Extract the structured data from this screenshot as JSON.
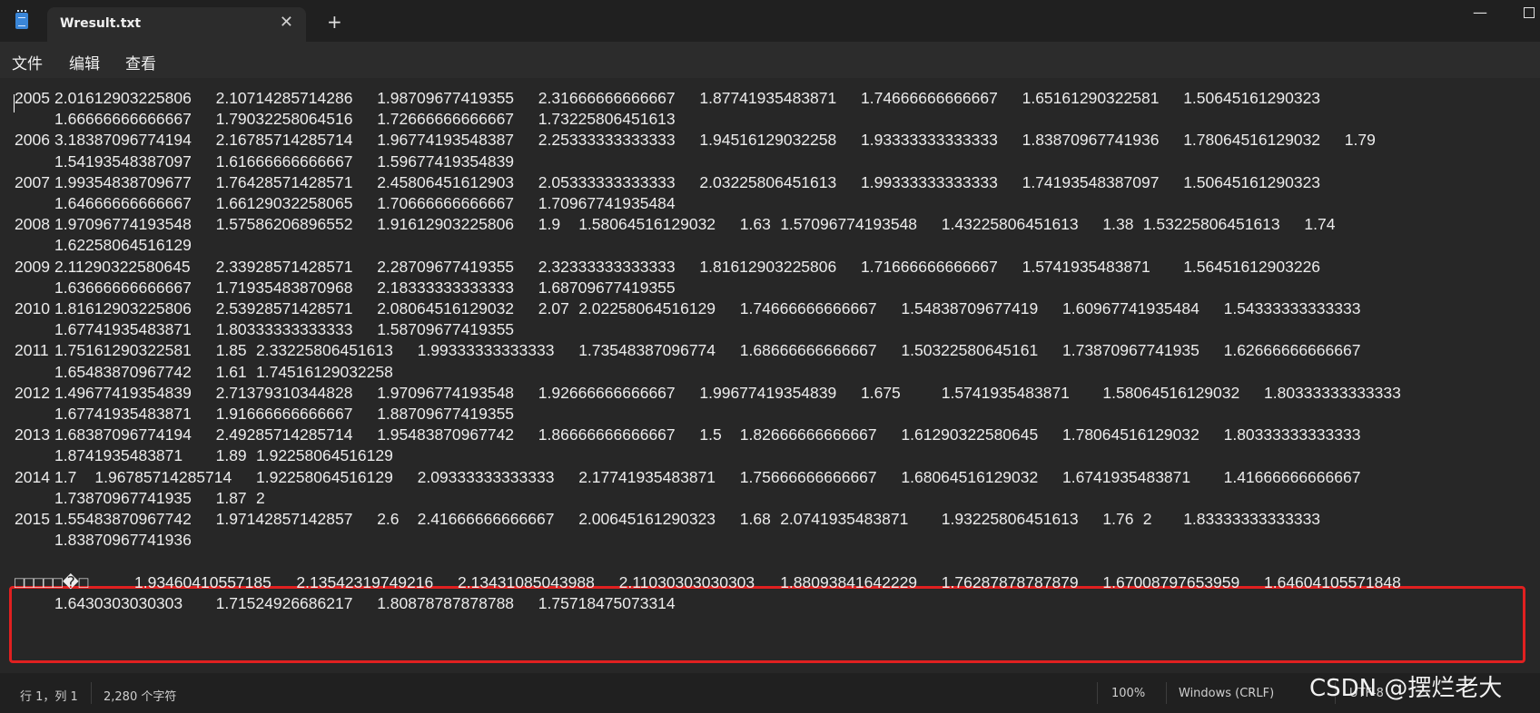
{
  "window": {
    "tab_title": "Wresult.txt",
    "new_tab_label": "+",
    "close_glyph": "✕",
    "minimize_glyph": "—"
  },
  "menu": {
    "items": [
      "文件",
      "编辑",
      "查看"
    ]
  },
  "editor": {
    "lines": [
      [
        "2005",
        "2.01612903225806",
        "2.10714285714286",
        "1.98709677419355",
        "2.31666666666667",
        "1.87741935483871",
        "1.74666666666667",
        "1.65161290322581",
        "1.50645161290323"
      ],
      [
        "",
        "1.66666666666667",
        "1.79032258064516",
        "1.72666666666667",
        "1.73225806451613"
      ],
      [
        "2006",
        "3.18387096774194",
        "2.16785714285714",
        "1.96774193548387",
        "2.25333333333333",
        "1.94516129032258",
        "1.93333333333333",
        "1.83870967741936",
        "1.78064516129032",
        "1.79"
      ],
      [
        "",
        "1.54193548387097",
        "1.61666666666667",
        "1.59677419354839"
      ],
      [
        "2007",
        "1.99354838709677",
        "1.76428571428571",
        "2.45806451612903",
        "2.05333333333333",
        "2.03225806451613",
        "1.99333333333333",
        "1.74193548387097",
        "1.50645161290323"
      ],
      [
        "",
        "1.64666666666667",
        "1.66129032258065",
        "1.70666666666667",
        "1.70967741935484"
      ],
      [
        "2008",
        "1.97096774193548",
        "1.57586206896552",
        "1.91612903225806",
        "1.9",
        "1.58064516129032",
        "1.63",
        "1.57096774193548",
        "1.43225806451613",
        "1.38",
        "1.53225806451613",
        "1.74"
      ],
      [
        "",
        "1.62258064516129"
      ],
      [
        "2009",
        "2.11290322580645",
        "2.33928571428571",
        "2.28709677419355",
        "2.32333333333333",
        "1.81612903225806",
        "1.71666666666667",
        "1.5741935483871",
        "1.56451612903226"
      ],
      [
        "",
        "1.63666666666667",
        "1.71935483870968",
        "2.18333333333333",
        "1.68709677419355"
      ],
      [
        "2010",
        "1.81612903225806",
        "2.53928571428571",
        "2.08064516129032",
        "2.07",
        "2.02258064516129",
        "1.74666666666667",
        "1.54838709677419",
        "1.60967741935484",
        "1.54333333333333"
      ],
      [
        "",
        "1.67741935483871",
        "1.80333333333333",
        "1.58709677419355"
      ],
      [
        "2011",
        "1.75161290322581",
        "1.85",
        "2.33225806451613",
        "1.99333333333333",
        "1.73548387096774",
        "1.68666666666667",
        "1.50322580645161",
        "1.73870967741935",
        "1.62666666666667"
      ],
      [
        "",
        "1.65483870967742",
        "1.61",
        "1.74516129032258"
      ],
      [
        "2012",
        "1.49677419354839",
        "2.71379310344828",
        "1.97096774193548",
        "1.92666666666667",
        "1.99677419354839",
        "1.675",
        "1.5741935483871",
        "1.58064516129032",
        "1.80333333333333"
      ],
      [
        "",
        "1.67741935483871",
        "1.91666666666667",
        "1.88709677419355"
      ],
      [
        "2013",
        "1.68387096774194",
        "2.49285714285714",
        "1.95483870967742",
        "1.86666666666667",
        "1.5",
        "1.82666666666667",
        "1.61290322580645",
        "1.78064516129032",
        "1.80333333333333"
      ],
      [
        "",
        "1.8741935483871",
        "1.89",
        "1.92258064516129"
      ],
      [
        "2014",
        "1.7",
        "1.96785714285714",
        "1.92258064516129",
        "2.09333333333333",
        "2.17741935483871",
        "1.75666666666667",
        "1.68064516129032",
        "1.6741935483871",
        "1.41666666666667"
      ],
      [
        "",
        "1.73870967741935",
        "1.87",
        "2"
      ],
      [
        "2015",
        "1.55483870967742",
        "1.97142857142857",
        "2.6",
        "2.41666666666667",
        "2.00645161290323",
        "1.68",
        "2.0741935483871",
        "1.93225806451613",
        "1.76",
        "2",
        "1.83333333333333"
      ],
      [
        "",
        "1.83870967741936"
      ],
      [
        "",
        ""
      ],
      [
        "□□□□□�□",
        "1.93460410557185",
        "2.13542319749216",
        "2.13431085043988",
        "2.11030303030303",
        "1.88093841642229",
        "1.76287878787879",
        "1.67008797653959",
        "1.64604105571848"
      ],
      [
        "",
        "1.6430303030303",
        "1.71524926686217",
        "1.80878787878788",
        "1.75718475073314"
      ]
    ]
  },
  "status": {
    "position": "行 1，列 1",
    "char_count": "2,280 个字符",
    "zoom": "100%",
    "line_ending": "Windows (CRLF)",
    "encoding": "UTF-8"
  },
  "watermark": "CSDN @摆烂老大",
  "colors": {
    "highlight_border": "#e02020",
    "background": "#272727",
    "text": "#ececec"
  }
}
